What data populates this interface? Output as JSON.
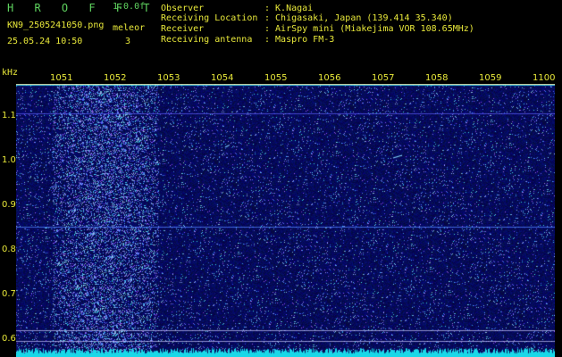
{
  "header": {
    "app_title": "H R O F F T",
    "version": "1.0.0f",
    "filename": "KN9_2505241050.png",
    "mode": "meleor",
    "datetime": "25.05.24 10:50",
    "count": "3",
    "info": [
      {
        "label": "Observer",
        "value": ": K.Nagai"
      },
      {
        "label": "Receiving Location",
        "value": ": Chigasaki, Japan (139.414 35.340)"
      },
      {
        "label": "Receiver",
        "value": ": AirSpy mini (Miakejima VOR 108.65MHz)"
      },
      {
        "label": "Receiving antenna",
        "value": ": Maspro FM-3"
      }
    ]
  },
  "axes": {
    "y_unit": "kHz",
    "x_ticks": [
      "1051",
      "1052",
      "1053",
      "1054",
      "1055",
      "1056",
      "1057",
      "1058",
      "1059",
      "1100"
    ],
    "y_ticks": [
      "1.1",
      "1.0",
      "0.9",
      "0.8",
      "0.7",
      "0.6"
    ]
  },
  "colors": {
    "background": "#000000",
    "header_text_green": "#5fd35f",
    "header_text_yellow": "#e8e83a",
    "spectrogram_base": "#06077a",
    "noise_floor": "#19d8e8"
  }
}
